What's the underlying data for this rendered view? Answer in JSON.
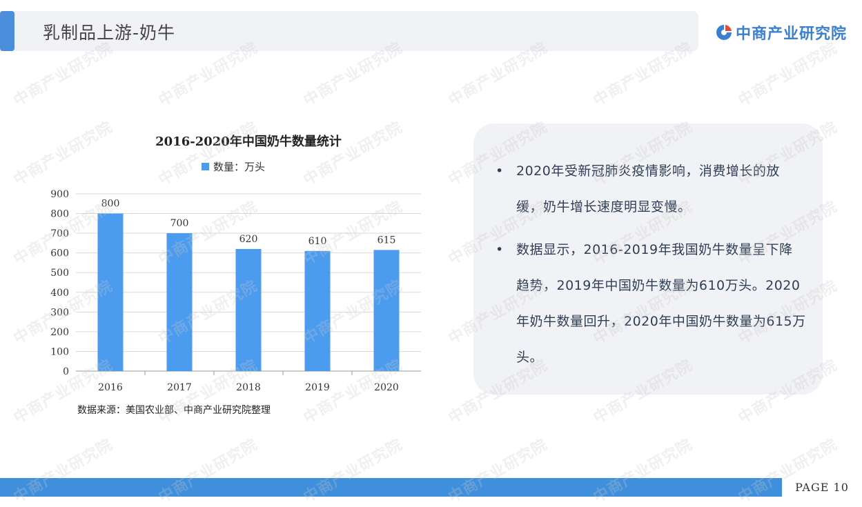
{
  "header": {
    "title": "乳制品上游-奶牛"
  },
  "logo": {
    "text": "中商产业研究院",
    "icon": "company-logo-icon",
    "color": "#3a7fd0"
  },
  "chart_data": {
    "type": "bar",
    "title": "2016-2020年中国奶牛数量统计",
    "legend": [
      "数量：万头"
    ],
    "categories": [
      "2016",
      "2017",
      "2018",
      "2019",
      "2020"
    ],
    "series": [
      {
        "name": "数量：万头",
        "values": [
          800,
          700,
          620,
          610,
          615
        ]
      }
    ],
    "ylim": [
      0,
      900
    ],
    "yticks": [
      0,
      100,
      200,
      300,
      400,
      500,
      600,
      700,
      800,
      900
    ],
    "grid": true,
    "legend_position": "top",
    "bar_color": "#4b9bef"
  },
  "source": "数据来源：美国农业部、中商产业研究院整理",
  "info": {
    "bullets": [
      "2020年受新冠肺炎疫情影响，消费增长的放缓，奶牛增长速度明显变慢。",
      "数据显示，2016-2019年我国奶牛数量呈下降趋势，2019年中国奶牛数量为610万头。2020年奶牛数量回升，2020年中国奶牛数量为615万头。"
    ]
  },
  "footer": {
    "page_label": "PAGE 10"
  },
  "watermark": {
    "text": "中商产业研究院"
  },
  "colors": {
    "accent": "#4b8fdc",
    "footer": "#3f8fdc",
    "panel": "#f1f2f6"
  }
}
